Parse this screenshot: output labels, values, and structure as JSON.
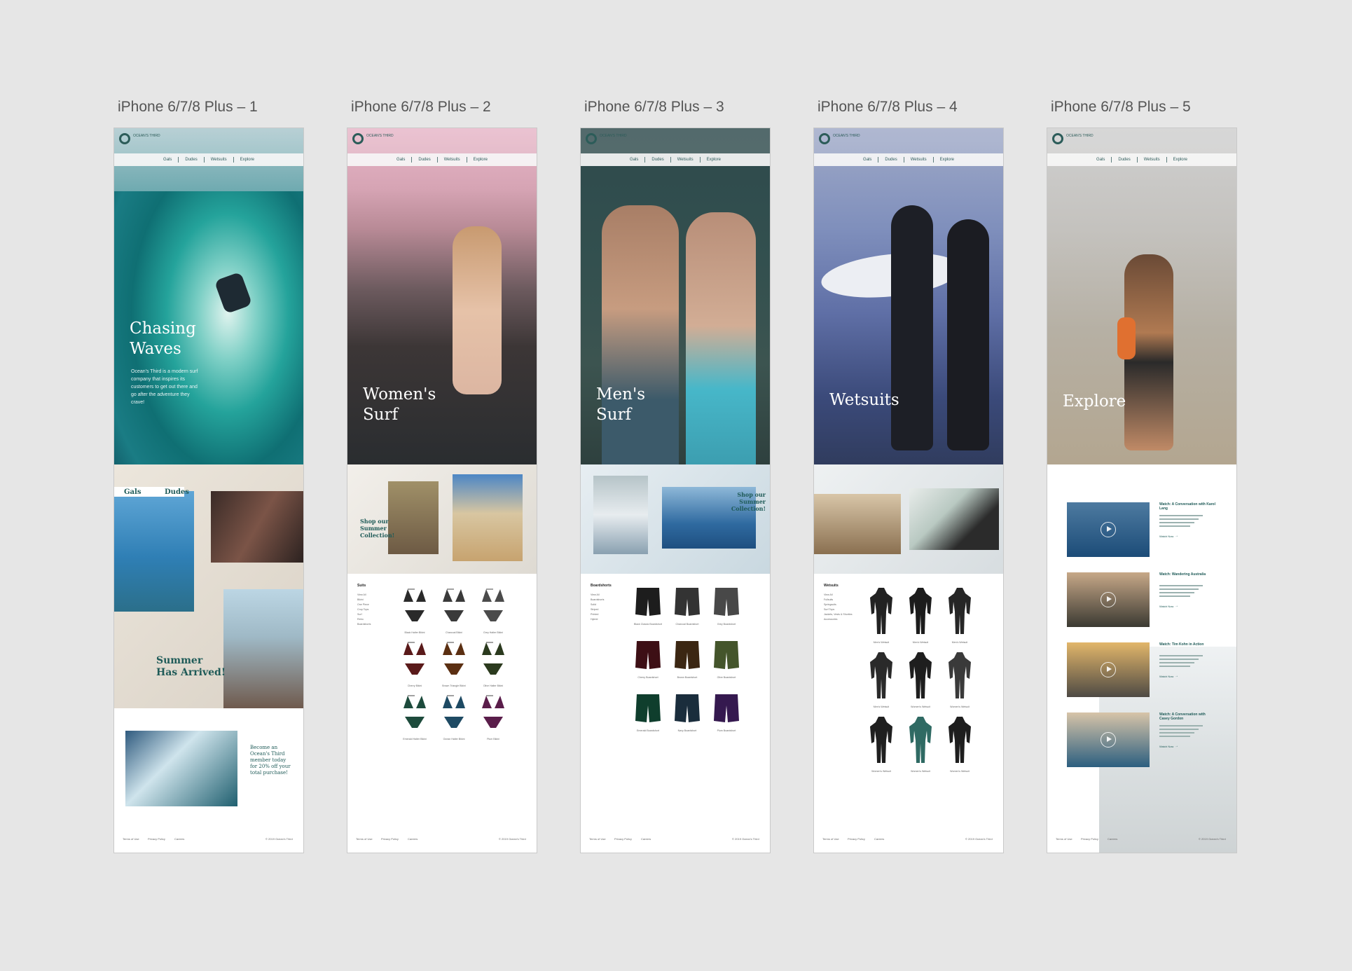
{
  "artboards": [
    {
      "title": "iPhone 6/7/8 Plus – 1",
      "hero_title": "Chasing Waves",
      "hero_sub": "Ocean's Third is a modern surf company that inspires its customers to get out there and go after the adventure they crave!"
    },
    {
      "title": "iPhone 6/7/8 Plus – 2",
      "hero_title": "Women's Surf",
      "collection": "Shop our Summer Collection!"
    },
    {
      "title": "iPhone 6/7/8 Plus – 3",
      "hero_title": "Men's Surf",
      "collection": "Shop our Summer Collection!"
    },
    {
      "title": "iPhone 6/7/8 Plus – 4",
      "hero_title": "Wetsuits"
    },
    {
      "title": "iPhone 6/7/8 Plus – 5",
      "hero_title": "Explore"
    }
  ],
  "nav": [
    "Gals",
    "Dudes",
    "Wetsuits",
    "Explore"
  ],
  "home": {
    "gals": "Gals",
    "dudes": "Dudes",
    "summer": "Summer Has Arrived!",
    "member": "Become an Ocean's Third member today for 20% off your total purchase!"
  },
  "logo_text": "OCEAN'S THIRD",
  "footer": {
    "terms": "Terms of Use",
    "privacy": "Privacy Policy",
    "careers": "Careers",
    "copyright": "© 2019 Ocean's Third"
  },
  "women": {
    "heading": "Suits",
    "categories": [
      "View All",
      "Bikini",
      "One Piece",
      "Crop Tops",
      "Surf",
      "Retro",
      "Boardshorts"
    ],
    "colors": [
      "#2a2a2a",
      "#3a3a3a",
      "#4b4b4b",
      "#5a1a1a",
      "#5b2f12",
      "#2b3a1e",
      "#1d4b3c",
      "#1e4a63",
      "#5a1d4a"
    ],
    "labels": [
      "Black Halter Bikini",
      "Charcoal Bikini",
      "Grey Halter Bikini",
      "Cherry Bikini",
      "Brown Triangle Bikini",
      "Olive Halter Bikini",
      "Emerald Halter Bikini",
      "Ocean Halter Bikini",
      "Plum Bikini"
    ]
  },
  "men": {
    "heading": "Boardshorts",
    "categories": [
      "View All",
      "Boardshorts",
      "Solid",
      "Striped",
      "Printed",
      "Hybrid"
    ],
    "colors": [
      "#1d1d1d",
      "#333333",
      "#484848",
      "#3d0f15",
      "#3b2612",
      "#44552b",
      "#0f3e2d",
      "#1a2d3c",
      "#35194f"
    ],
    "labels": [
      "Black Classic Boardshort",
      "Charcoal Boardshort",
      "Grey Boardshort",
      "Cherry Boardshort",
      "Brown Boardshort",
      "Olive Boardshort",
      "Emerald Boardshort",
      "Navy Boardshort",
      "Plum Boardshort"
    ]
  },
  "wetsuits": {
    "heading": "Wetsuits",
    "categories": [
      "View All",
      "Fullsuits",
      "Springsuits",
      "Surf Tops",
      "Jackets, Vests & Shorties",
      "Accessories"
    ],
    "colors": [
      "#222222",
      "#1c1c1c",
      "#262626",
      "#2a2a2a",
      "#1e1e1e",
      "#3a3a3a",
      "#1f1f1f",
      "#2f6a63",
      "#1e1e1e"
    ],
    "labels": [
      "Men's Wetsuit",
      "Men's Wetsuit",
      "Men's Wetsuit",
      "Men's Wetsuit",
      "Women's Wetsuit",
      "Women's Wetsuit",
      "Women's Wetsuit",
      "Women's Wetsuit",
      "Women's Wetsuit"
    ]
  },
  "explore": {
    "items": [
      {
        "title": "Watch: A Conversation with Karol Lang",
        "cta": "Watch Now"
      },
      {
        "title": "Watch: Wandering Australia",
        "cta": "Watch Now"
      },
      {
        "title": "Watch: Tim Kohn in Action",
        "cta": "Watch Now"
      },
      {
        "title": "Watch: A Conversation with Casey Gordon",
        "cta": "Watch Now"
      }
    ]
  }
}
